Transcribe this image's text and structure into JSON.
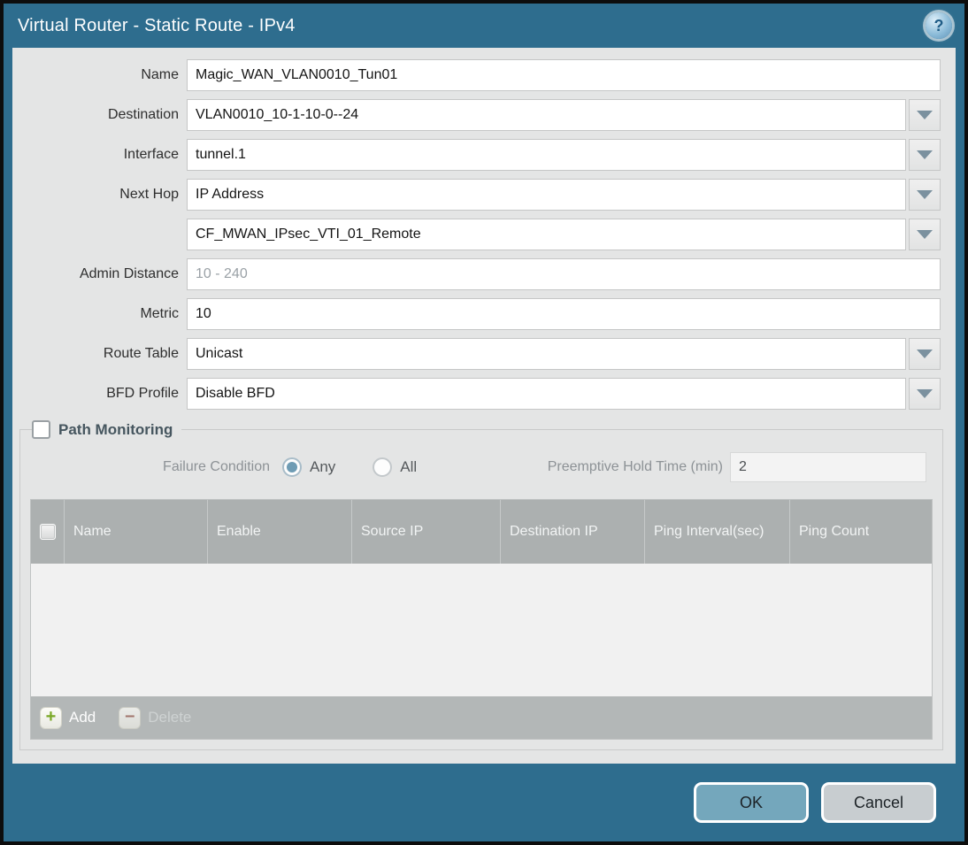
{
  "dialog": {
    "title": "Virtual Router - Static Route - IPv4",
    "help_glyph": "?"
  },
  "colors": {
    "accent_teal": "#2e6d8e",
    "ok_button": "#74a7bc",
    "cancel_button": "#c8cdd0",
    "table_header_gray": "#acb0b0",
    "add_plus_green": "#7aa826",
    "delete_minus_red": "#9c5f55",
    "radio_selected_dot": "#6f9cb4"
  },
  "form": {
    "fields": [
      {
        "label": "Name",
        "value": "Magic_WAN_VLAN0010_Tun01",
        "type": "text"
      },
      {
        "label": "Destination",
        "value": "VLAN0010_10-1-10-0--24",
        "type": "dropdown"
      },
      {
        "label": "Interface",
        "value": "tunnel.1",
        "type": "dropdown"
      },
      {
        "label": "Next Hop",
        "value": "IP Address",
        "type": "dropdown"
      },
      {
        "label": "",
        "value": "CF_MWAN_IPsec_VTI_01_Remote",
        "type": "dropdown"
      },
      {
        "label": "Admin Distance",
        "value": "",
        "placeholder": "10 - 240",
        "type": "text"
      },
      {
        "label": "Metric",
        "value": "10",
        "type": "text"
      },
      {
        "label": "Route Table",
        "value": "Unicast",
        "type": "dropdown"
      },
      {
        "label": "BFD Profile",
        "value": "Disable BFD",
        "type": "dropdown"
      }
    ]
  },
  "path_monitoring": {
    "title": "Path Monitoring",
    "enabled": false,
    "failure_condition": {
      "label": "Failure Condition",
      "options": [
        {
          "label": "Any",
          "selected": true
        },
        {
          "label": "All",
          "selected": false
        }
      ]
    },
    "preemptive_hold": {
      "label": "Preemptive Hold Time (min)",
      "value": "2"
    },
    "table": {
      "columns": [
        "Name",
        "Enable",
        "Source IP",
        "Destination IP",
        "Ping Interval(sec)",
        "Ping Count"
      ],
      "rows": []
    },
    "add_label": "Add",
    "delete_label": "Delete"
  },
  "footer": {
    "ok_label": "OK",
    "cancel_label": "Cancel"
  }
}
